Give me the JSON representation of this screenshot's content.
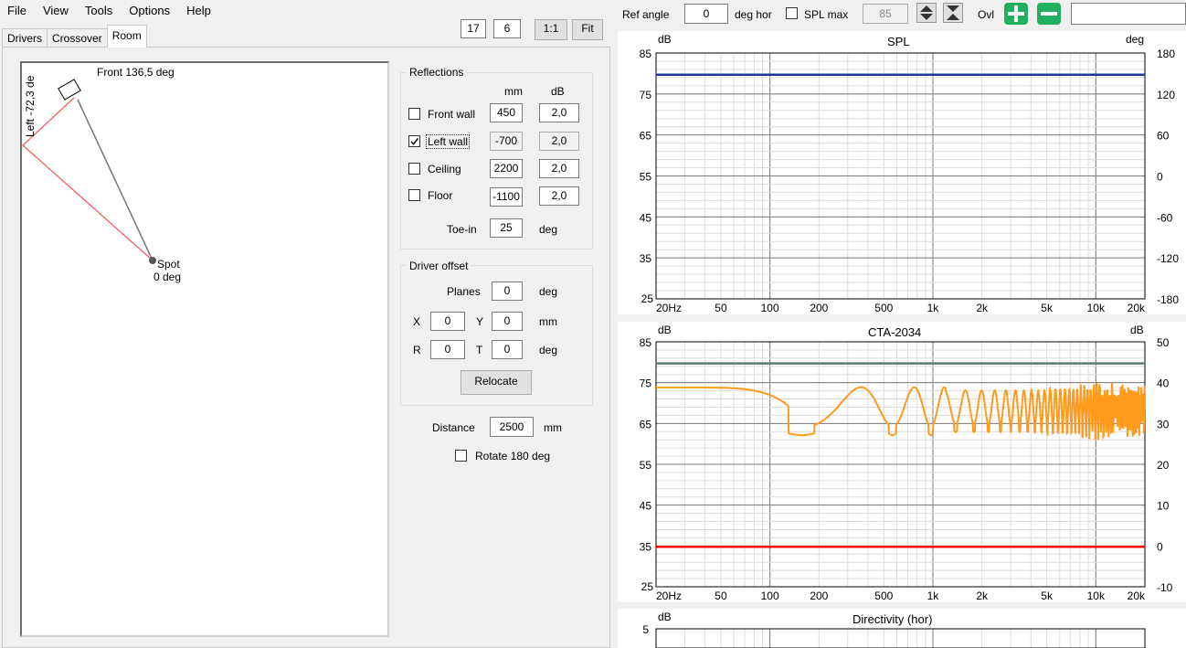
{
  "menu": [
    "File",
    "View",
    "Tools",
    "Options",
    "Help"
  ],
  "tabs": [
    "Drivers",
    "Crossover",
    "Room"
  ],
  "view_buttons": {
    "a": "17",
    "b": "6",
    "ratio": "1:1",
    "fit": "Fit"
  },
  "room": {
    "front_label": "Front 136,5 deg",
    "left_label": "Left -72,3 de",
    "spot_label": "Spot",
    "spot_angle": "0 deg"
  },
  "reflections": {
    "title": "Reflections",
    "col_mm": "mm",
    "col_db": "dB",
    "rows": [
      {
        "label": "Front wall",
        "checked": false,
        "mm": "450",
        "db": "2,0"
      },
      {
        "label": "Left wall",
        "checked": true,
        "mm": "-700",
        "db": "2,0"
      },
      {
        "label": "Ceiling",
        "checked": false,
        "mm": "2200",
        "db": "2,0"
      },
      {
        "label": "Floor",
        "checked": false,
        "mm": "-1100",
        "db": "2,0"
      }
    ],
    "toein_label": "Toe-in",
    "toein_value": "25",
    "toein_unit": "deg"
  },
  "driver_offset": {
    "title": "Driver offset",
    "planes_label": "Planes",
    "planes_value": "0",
    "planes_unit": "deg",
    "x_label": "X",
    "x_value": "0",
    "y_label": "Y",
    "y_value": "0",
    "xy_unit": "mm",
    "r_label": "R",
    "r_value": "0",
    "t_label": "T",
    "t_value": "0",
    "rt_unit": "deg",
    "relocate": "Relocate"
  },
  "distance": {
    "label": "Distance",
    "value": "2500",
    "unit": "mm"
  },
  "rotate": {
    "label": "Rotate 180 deg",
    "checked": false
  },
  "toolbar": {
    "ref_angle_label": "Ref angle",
    "ref_angle_value": "0",
    "ref_angle_unit": "deg hor",
    "spl_max_label": "SPL max",
    "spl_max_value": "85",
    "ovl_label": "Ovl",
    "search_value": ""
  },
  "colors": {
    "spl_line": "#1f3a93",
    "cta_listen": "#5e7a6b",
    "cta_curve": "#ff9a1a",
    "cta_red": "#ff0000",
    "green_btn": "#20b060"
  },
  "chart_data": [
    {
      "type": "line",
      "title": "SPL",
      "ylabel_left": "dB",
      "ylabel_right": "deg",
      "x_ticks": [
        "20Hz",
        "50",
        "100",
        "200",
        "500",
        "1k",
        "2k",
        "5k",
        "10k",
        "20k"
      ],
      "x_tick_values": [
        20,
        50,
        100,
        200,
        500,
        1000,
        2000,
        5000,
        10000,
        20000
      ],
      "y_ticks": [
        25,
        35,
        45,
        55,
        65,
        75,
        85
      ],
      "y2_ticks": [
        -180,
        -120,
        -60,
        0,
        60,
        120,
        180
      ],
      "xlim": [
        20,
        20000
      ],
      "ylim": [
        25,
        85
      ],
      "y2lim": [
        -180,
        180
      ],
      "x_scale": "log",
      "grid": true,
      "series": [
        {
          "values": [
            {
              "x": 20,
              "y": 79.7
            },
            {
              "x": 20000,
              "y": 79.7
            }
          ],
          "color": "#1f3a93"
        }
      ]
    },
    {
      "type": "line",
      "title": "CTA-2034",
      "ylabel_left": "dB",
      "ylabel_right": "dB",
      "x_ticks": [
        "20Hz",
        "50",
        "100",
        "200",
        "500",
        "1k",
        "2k",
        "5k",
        "10k",
        "20k"
      ],
      "x_tick_values": [
        20,
        50,
        100,
        200,
        500,
        1000,
        2000,
        5000,
        10000,
        20000
      ],
      "y_ticks": [
        25,
        35,
        45,
        55,
        65,
        75,
        85
      ],
      "y2_ticks": [
        -10,
        0,
        10,
        20,
        30,
        40,
        50
      ],
      "xlim": [
        20,
        20000
      ],
      "ylim": [
        25,
        85
      ],
      "y2lim": [
        -10,
        50
      ],
      "x_scale": "log",
      "grid": true,
      "series": [
        {
          "values": [
            {
              "x": 20,
              "y": 79.7
            },
            {
              "x": 20000,
              "y": 79.7
            }
          ],
          "color": "#5e7a6b"
        },
        {
          "values": [
            {
              "x": 20,
              "y": 34.8
            },
            {
              "x": 20000,
              "y": 34.8
            }
          ],
          "color": "#ff0000"
        },
        {
          "values": [
            {
              "x": 20,
              "y": 73.8
            },
            {
              "x": 50,
              "y": 73.5
            },
            {
              "x": 100,
              "y": 72.0
            },
            {
              "x": 150,
              "y": 68.0
            },
            {
              "x": 200,
              "y": 62.0
            },
            {
              "x": 260,
              "y": 69.0
            },
            {
              "x": 350,
              "y": 74.0
            },
            {
              "x": 450,
              "y": 70.0
            },
            {
              "x": 600,
              "y": 62.0
            },
            {
              "x": 700,
              "y": 71.0
            },
            {
              "x": 900,
              "y": 73.0
            },
            {
              "x": 1000,
              "y": 64.0
            },
            {
              "x": 20000,
              "y": 74.0
            }
          ],
          "color": "#ff9a1a"
        }
      ]
    },
    {
      "type": "line",
      "title": "Directivity (hor)",
      "ylabel_left": "dB",
      "y_ticks": [
        5
      ],
      "xlim": [
        20,
        20000
      ],
      "x_scale": "log",
      "grid": true,
      "series": []
    }
  ]
}
